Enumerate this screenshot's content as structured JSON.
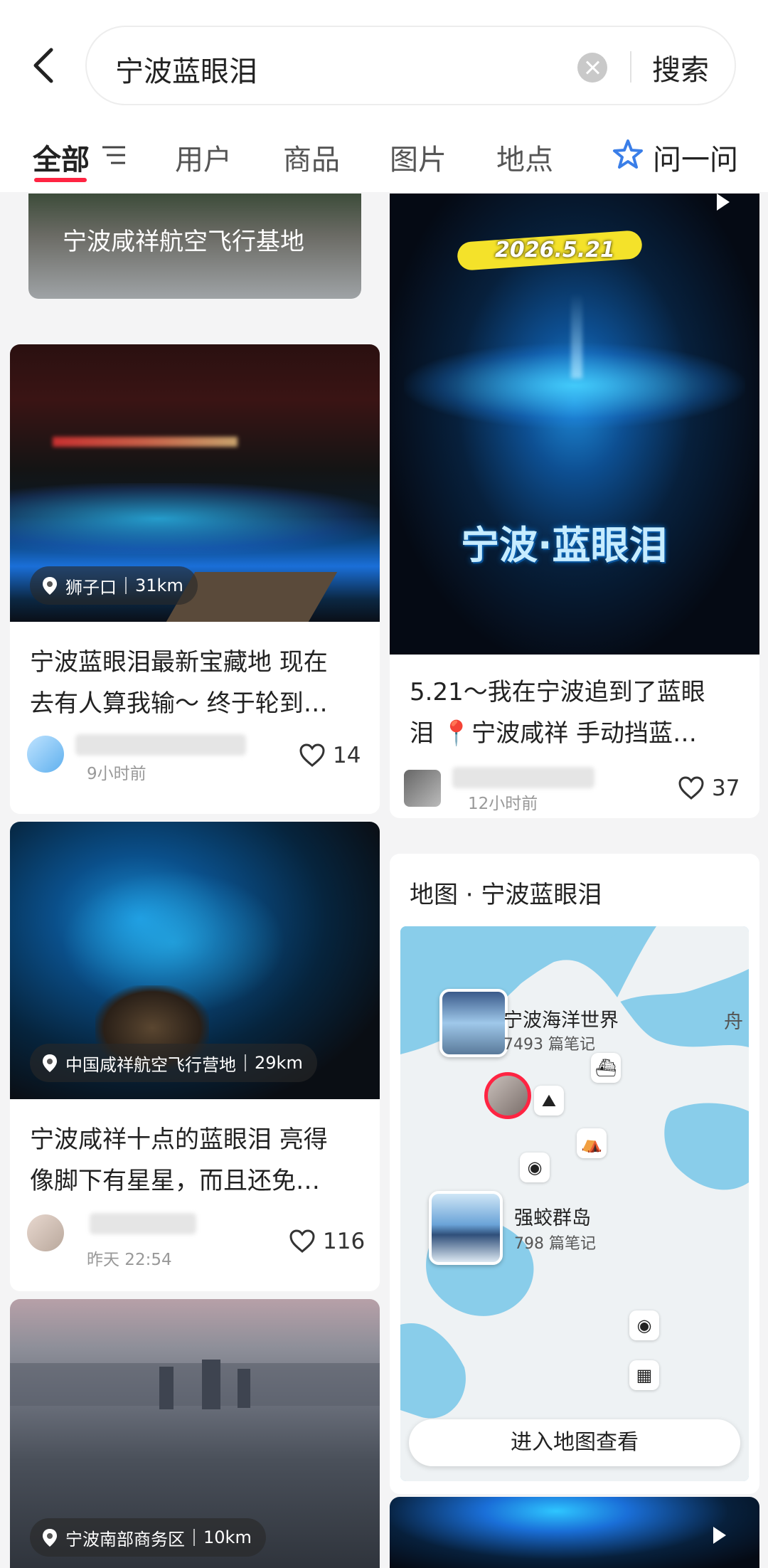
{
  "header": {
    "search_query": "宁波蓝眼泪",
    "search_button": "搜索"
  },
  "tabs": [
    {
      "label": "全部"
    },
    {
      "label": "用户"
    },
    {
      "label": "商品"
    },
    {
      "label": "图片"
    },
    {
      "label": "地点"
    }
  ],
  "ask_label": "问一问",
  "left_column": {
    "top_card_caption": "宁波咸祥航空飞行基地",
    "posts": [
      {
        "location": "狮子口",
        "distance": "31km",
        "title_line1": "宁波蓝眼泪最新宝藏地 现在",
        "title_line2": "去有人算我输～ 终于轮到…",
        "time": "9小时前",
        "likes": "14"
      },
      {
        "location": "中国咸祥航空飞行营地",
        "distance": "29km",
        "title_line1": "宁波咸祥十点的蓝眼泪 亮得",
        "title_line2": "像脚下有星星，而且还免…",
        "time": "昨天 22:54",
        "likes": "116"
      },
      {
        "location": "宁波南部商务区",
        "distance": "10km"
      }
    ]
  },
  "right_column": {
    "video_post": {
      "overlay_date": "2026.5.21",
      "overlay_title": "宁波·蓝眼泪",
      "title_line1": "5.21～我在宁波追到了蓝眼",
      "title_line2": "泪 📍宁波咸祥 手动挡蓝…",
      "time": "12小时前",
      "likes": "37"
    },
    "map_card": {
      "title": "地图 · 宁波蓝眼泪",
      "places": [
        {
          "name": "宁波海洋世界",
          "notes": "7493 篇笔记"
        },
        {
          "name": "强蛟群岛",
          "notes": "798 篇笔记"
        }
      ],
      "edge_label": "舟",
      "button": "进入地图查看"
    }
  },
  "colors": {
    "accent": "#ff2442",
    "glow": "#2ec6ff",
    "map_water": "#89cdea"
  }
}
